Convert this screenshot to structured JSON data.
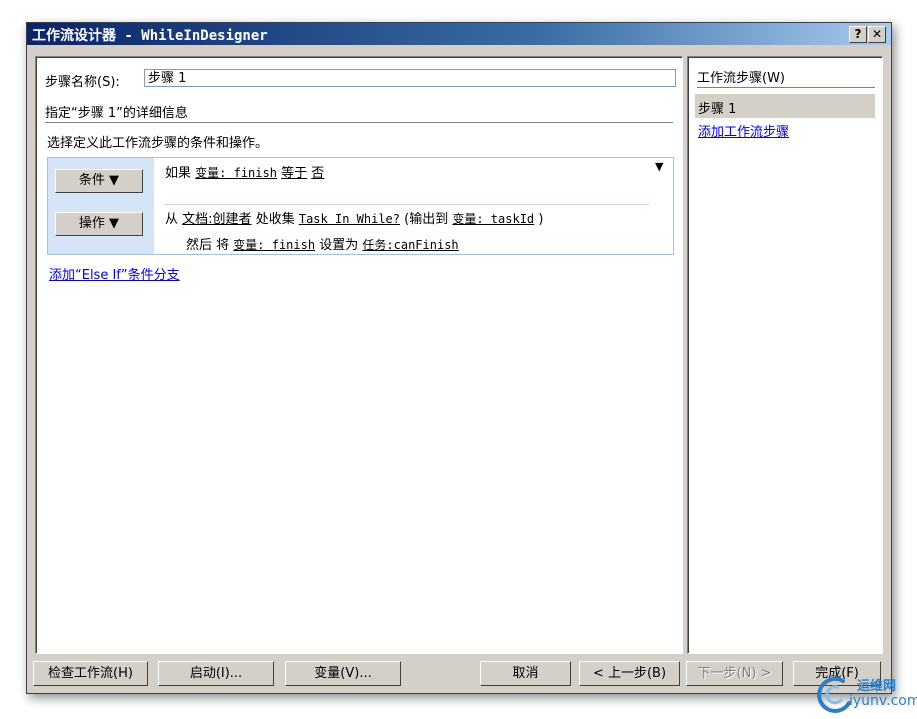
{
  "window": {
    "title": "工作流设计器 - WhileInDesigner",
    "help_glyph": "?",
    "close_glyph": "✕"
  },
  "step": {
    "name_label": "步骤名称(S):",
    "name_value": "步骤 1",
    "details_heading": "指定“步骤 1”的详细信息",
    "instruction": "选择定义此工作流步骤的条件和操作。"
  },
  "rule": {
    "condition_button": "条件 ▼",
    "action_button": "操作 ▼",
    "dropdown_glyph": "▼",
    "condition": {
      "prefix": "如果",
      "var": "变量: finish",
      "op": "等于",
      "value": "否"
    },
    "action1": {
      "from": "从",
      "source": "文档:创建者",
      "collect": "处收集",
      "task": "Task In While?",
      "output_open": "(输出到",
      "output_var": "变量: taskId",
      "output_close": ")"
    },
    "action2": {
      "then": "然后 将",
      "var": "变量: finish",
      "set": "设置为",
      "value": "任务:canFinish"
    },
    "add_else_if": "添加“Else If”条件分支"
  },
  "sidebar": {
    "heading": "工作流步骤(W)",
    "items": [
      "步骤 1"
    ],
    "add_step": "添加工作流步骤"
  },
  "buttons": {
    "check": "检查工作流(H)",
    "start": "启动(I)...",
    "variables": "变量(V)...",
    "cancel": "取消",
    "back": "< 上一步(B)",
    "next": "下一步(N) >",
    "finish": "完成(F)"
  },
  "watermark": {
    "brand": "运维网",
    "url": "iyunv.com"
  }
}
